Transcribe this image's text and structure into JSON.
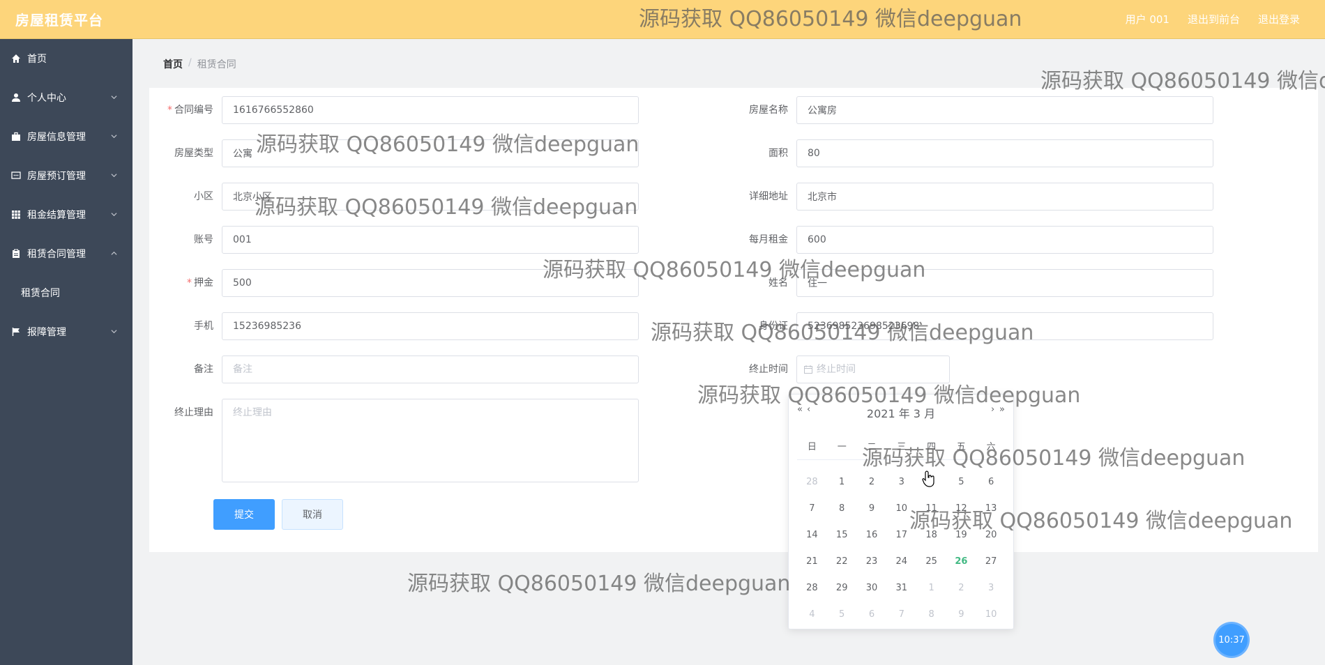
{
  "header": {
    "brand": "房屋租赁平台",
    "nav": [
      "用户 001",
      "退出到前台",
      "退出登录"
    ]
  },
  "sidebar": {
    "items": [
      {
        "label": "首页",
        "icon": "home-icon"
      },
      {
        "label": "个人中心",
        "icon": "user-icon"
      },
      {
        "label": "房屋信息管理",
        "icon": "briefcase-icon"
      },
      {
        "label": "房屋预订管理",
        "icon": "chat-icon"
      },
      {
        "label": "租金结算管理",
        "icon": "grid-icon"
      },
      {
        "label": "租赁合同管理",
        "icon": "clipboard-icon"
      },
      {
        "label": "报障管理",
        "icon": "flag-icon"
      }
    ],
    "submenu_label": "租赁合同"
  },
  "breadcrumb": {
    "home": "首页",
    "separator": "/",
    "current": "租赁合同"
  },
  "form": {
    "contract_no": {
      "label": "合同编号",
      "value": "1616766552860"
    },
    "house_name": {
      "label": "房屋名称",
      "value": "公寓房"
    },
    "house_type": {
      "label": "房屋类型",
      "value": "公寓"
    },
    "area": {
      "label": "面积",
      "value": "80"
    },
    "community": {
      "label": "小区",
      "value": "北京小区"
    },
    "address": {
      "label": "详细地址",
      "value": "北京市"
    },
    "account": {
      "label": "账号",
      "value": "001"
    },
    "monthly_rent": {
      "label": "每月租金",
      "value": "600"
    },
    "deposit": {
      "label": "押金",
      "value": "500"
    },
    "name": {
      "label": "姓名",
      "value": "住一"
    },
    "phone": {
      "label": "手机",
      "value": "15236985236"
    },
    "id_card": {
      "label": "身份证",
      "value": "523698523698523698"
    },
    "remark": {
      "label": "备注",
      "placeholder": "备注"
    },
    "end_time": {
      "label": "终止时间",
      "placeholder": "终止时间"
    },
    "end_reason": {
      "label": "终止理由",
      "placeholder": "终止理由"
    },
    "submit_label": "提交",
    "cancel_label": "取消"
  },
  "datepicker": {
    "title": "2021 年  3 月",
    "weekdays": [
      "日",
      "一",
      "二",
      "三",
      "四",
      "五",
      "六"
    ],
    "weeks": [
      [
        "28",
        "1",
        "2",
        "3",
        "4",
        "5",
        "6"
      ],
      [
        "7",
        "8",
        "9",
        "10",
        "11",
        "12",
        "13"
      ],
      [
        "14",
        "15",
        "16",
        "17",
        "18",
        "19",
        "20"
      ],
      [
        "21",
        "22",
        "23",
        "24",
        "25",
        "26",
        "27"
      ],
      [
        "28",
        "29",
        "30",
        "31",
        "1",
        "2",
        "3"
      ],
      [
        "4",
        "5",
        "6",
        "7",
        "8",
        "9",
        "10"
      ]
    ],
    "today": "26",
    "accent_color": "#42b983"
  },
  "clock": "10:37",
  "watermark": "源码获取 QQ86050149 微信deepguan",
  "colors": {
    "topbar": "#fdd57b",
    "sidebar": "#3d4858",
    "primary": "#409eff"
  }
}
